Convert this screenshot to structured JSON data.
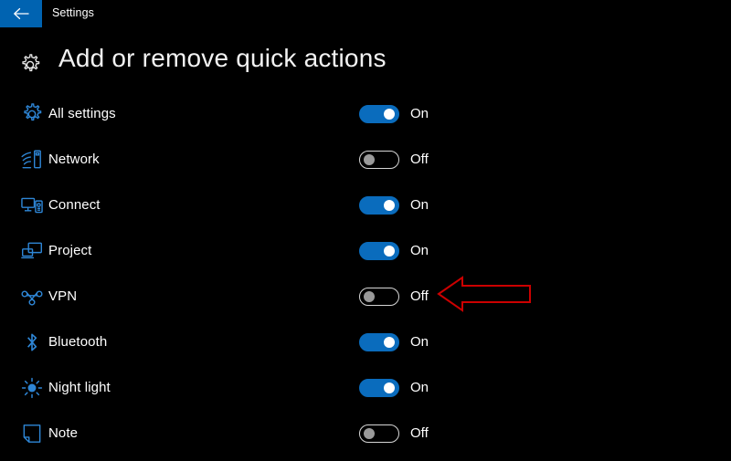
{
  "window": {
    "titlebar_label": "Settings",
    "back_icon": "arrow-left-icon",
    "back_button_color": "#0063B1",
    "background_color": "#000000"
  },
  "header": {
    "icon": "gear-icon",
    "title": "Add or remove quick actions"
  },
  "theme": {
    "accent": "#0A6CBD",
    "icon_blue": "#2E86D6",
    "text": "#ffffff",
    "toggle_off_border": "#d6d6d6",
    "toggle_off_knob": "#9a9a9a",
    "annotation": "#CC0000"
  },
  "quick_actions": [
    {
      "icon": "gear-icon",
      "label": "All settings",
      "state": "On",
      "on": true
    },
    {
      "icon": "wifi-icon",
      "label": "Network",
      "state": "Off",
      "on": false
    },
    {
      "icon": "connect-icon",
      "label": "Connect",
      "state": "On",
      "on": true
    },
    {
      "icon": "project-icon",
      "label": "Project",
      "state": "On",
      "on": true
    },
    {
      "icon": "vpn-icon",
      "label": "VPN",
      "state": "Off",
      "on": false
    },
    {
      "icon": "bluetooth-icon",
      "label": "Bluetooth",
      "state": "On",
      "on": true
    },
    {
      "icon": "sun-icon",
      "label": "Night light",
      "state": "On",
      "on": true
    },
    {
      "icon": "note-icon",
      "label": "Note",
      "state": "Off",
      "on": false
    }
  ],
  "annotation": {
    "shape": "left-arrow-outline",
    "points_at": "VPN",
    "color": "#CC0000"
  }
}
